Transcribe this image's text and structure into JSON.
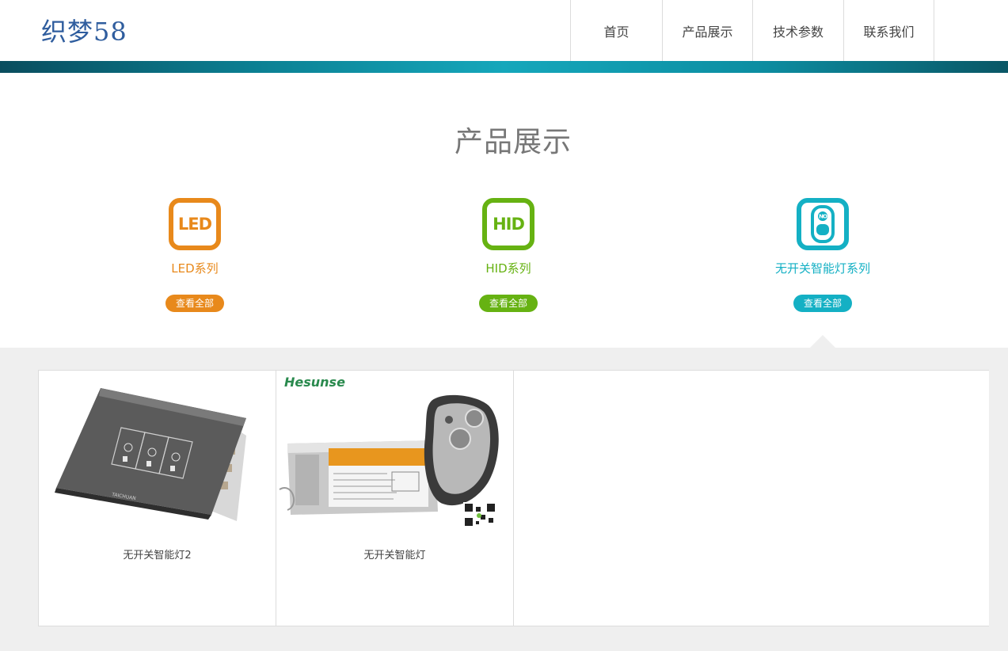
{
  "header": {
    "logo_text": "织梦58",
    "nav": [
      {
        "label": "首页"
      },
      {
        "label": "产品展示"
      },
      {
        "label": "技术参数"
      },
      {
        "label": "联系我们"
      }
    ]
  },
  "section": {
    "title": "产品展示"
  },
  "categories": [
    {
      "icon_text": "LED",
      "name": "LED系列",
      "button": "查看全部",
      "color": "#e8891b",
      "icon": "led-icon"
    },
    {
      "icon_text": "HID",
      "name": "HID系列",
      "button": "查看全部",
      "color": "#66b212",
      "icon": "hid-icon"
    },
    {
      "icon_text": "NO",
      "name": "无开关智能灯系列",
      "button": "查看全部",
      "color": "#14b0c4",
      "icon": "remote-icon"
    }
  ],
  "products": [
    {
      "title": "无开关智能灯2",
      "image": "touch-panel-image"
    },
    {
      "title": "无开关智能灯",
      "image": "remote-ballast-image",
      "brand": "Hesunse"
    }
  ],
  "colors": {
    "teal_bar": "#0b7f92",
    "gray_bg": "#efefef"
  }
}
